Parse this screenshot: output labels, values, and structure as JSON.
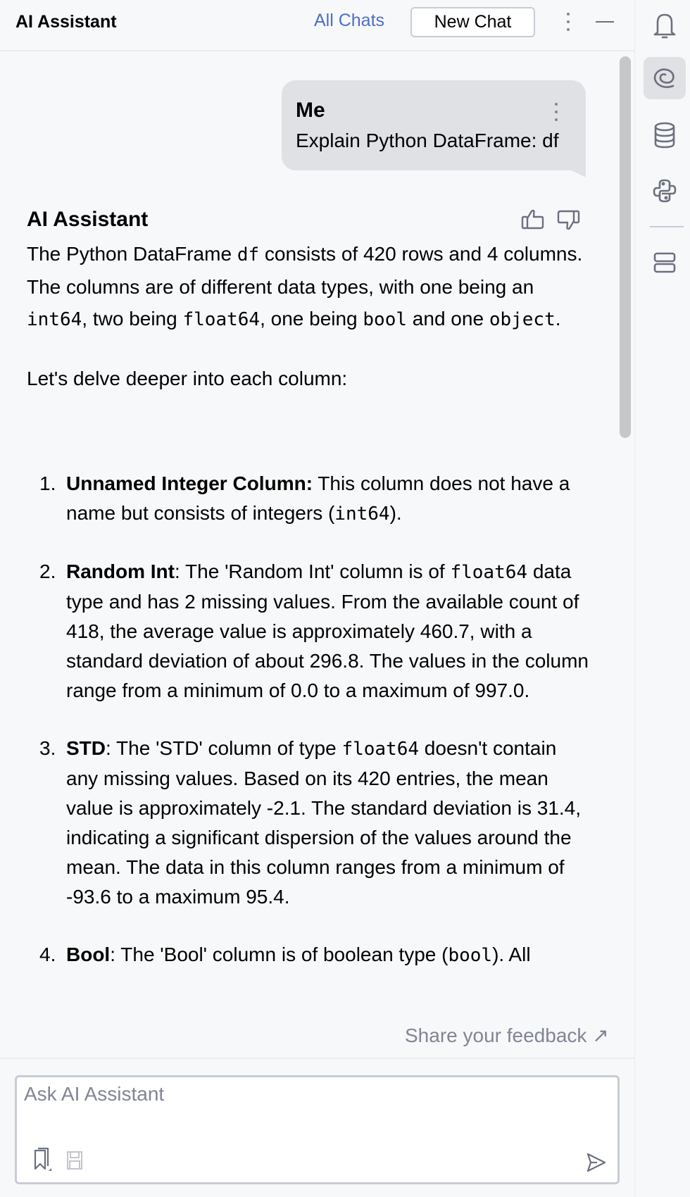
{
  "header": {
    "title": "AI Assistant",
    "all_chats_label": "All Chats",
    "new_chat_label": "New Chat"
  },
  "user_message": {
    "author": "Me",
    "text": "Explain Python DataFrame: df"
  },
  "assistant_message": {
    "author": "AI Assistant",
    "intro": {
      "t1": "The Python DataFrame ",
      "c1": "df",
      "t2": " consists of 420 rows and 4 columns. The columns are of different data types, with one being an ",
      "c2": "int64",
      "t3": ", two being ",
      "c3": "float64",
      "t4": ", one being ",
      "c4": "bool",
      "t5": " and one ",
      "c5": "object",
      "t6": "."
    },
    "delve": "Let's delve deeper into each column:",
    "items": [
      {
        "number": "1.",
        "name": "Unnamed Integer Column:",
        "t1": " This column does not have a name but consists of integers (",
        "code": "int64",
        "t2": ")."
      },
      {
        "number": "2.",
        "name": "Random Int",
        "t1": ": The 'Random Int' column is of ",
        "code": "float64",
        "t2": " data type and has 2 missing values. From the available count of 418, the average value is approximately 460.7, with a standard deviation of about 296.8. The values in the column range from a minimum of 0.0 to a maximum of 997.0."
      },
      {
        "number": "3.",
        "name": "STD",
        "t1": ": The 'STD' column of type ",
        "code": "float64",
        "t2": " doesn't contain any missing values. Based on its 420 entries, the mean value is approximately -2.1. The standard deviation is 31.4, indicating a significant dispersion of the values around the mean. The data in this column ranges from a minimum of -93.6 to a maximum 95.4."
      },
      {
        "number": "4.",
        "name": "Bool",
        "t1": ": The 'Bool' column is of boolean type (",
        "code": "bool",
        "t2": "). All"
      }
    ]
  },
  "feedback_label": "Share your feedback ↗",
  "input": {
    "placeholder": "Ask AI Assistant",
    "value": ""
  },
  "toolstrip": {
    "items": [
      "bell-icon",
      "ai-assistant-icon",
      "database-icon",
      "python-icon",
      "structure-icon"
    ],
    "active": "ai-assistant-icon"
  },
  "colors": {
    "accent_link": "#4a6fc7",
    "bubble_bg": "#dfe1e5",
    "panel_bg": "#f7f8fa",
    "muted_text": "#818594"
  }
}
